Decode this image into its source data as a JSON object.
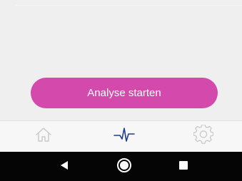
{
  "main": {
    "analyse_button_label": "Analyse starten"
  },
  "tab_bar": {
    "items": [
      {
        "icon": "home-icon",
        "active": false
      },
      {
        "icon": "heartbeat-icon",
        "active": true
      },
      {
        "icon": "gear-icon",
        "active": false
      }
    ],
    "active_color": "#1e3e8a",
    "inactive_color": "#c8c8c8"
  },
  "system_nav": {
    "buttons": [
      {
        "icon": "back-triangle-icon"
      },
      {
        "icon": "home-circle-icon"
      },
      {
        "icon": "recents-square-icon"
      }
    ]
  },
  "colors": {
    "accent": "#d349ac",
    "background": "#efefef",
    "nav_background": "#050505"
  }
}
